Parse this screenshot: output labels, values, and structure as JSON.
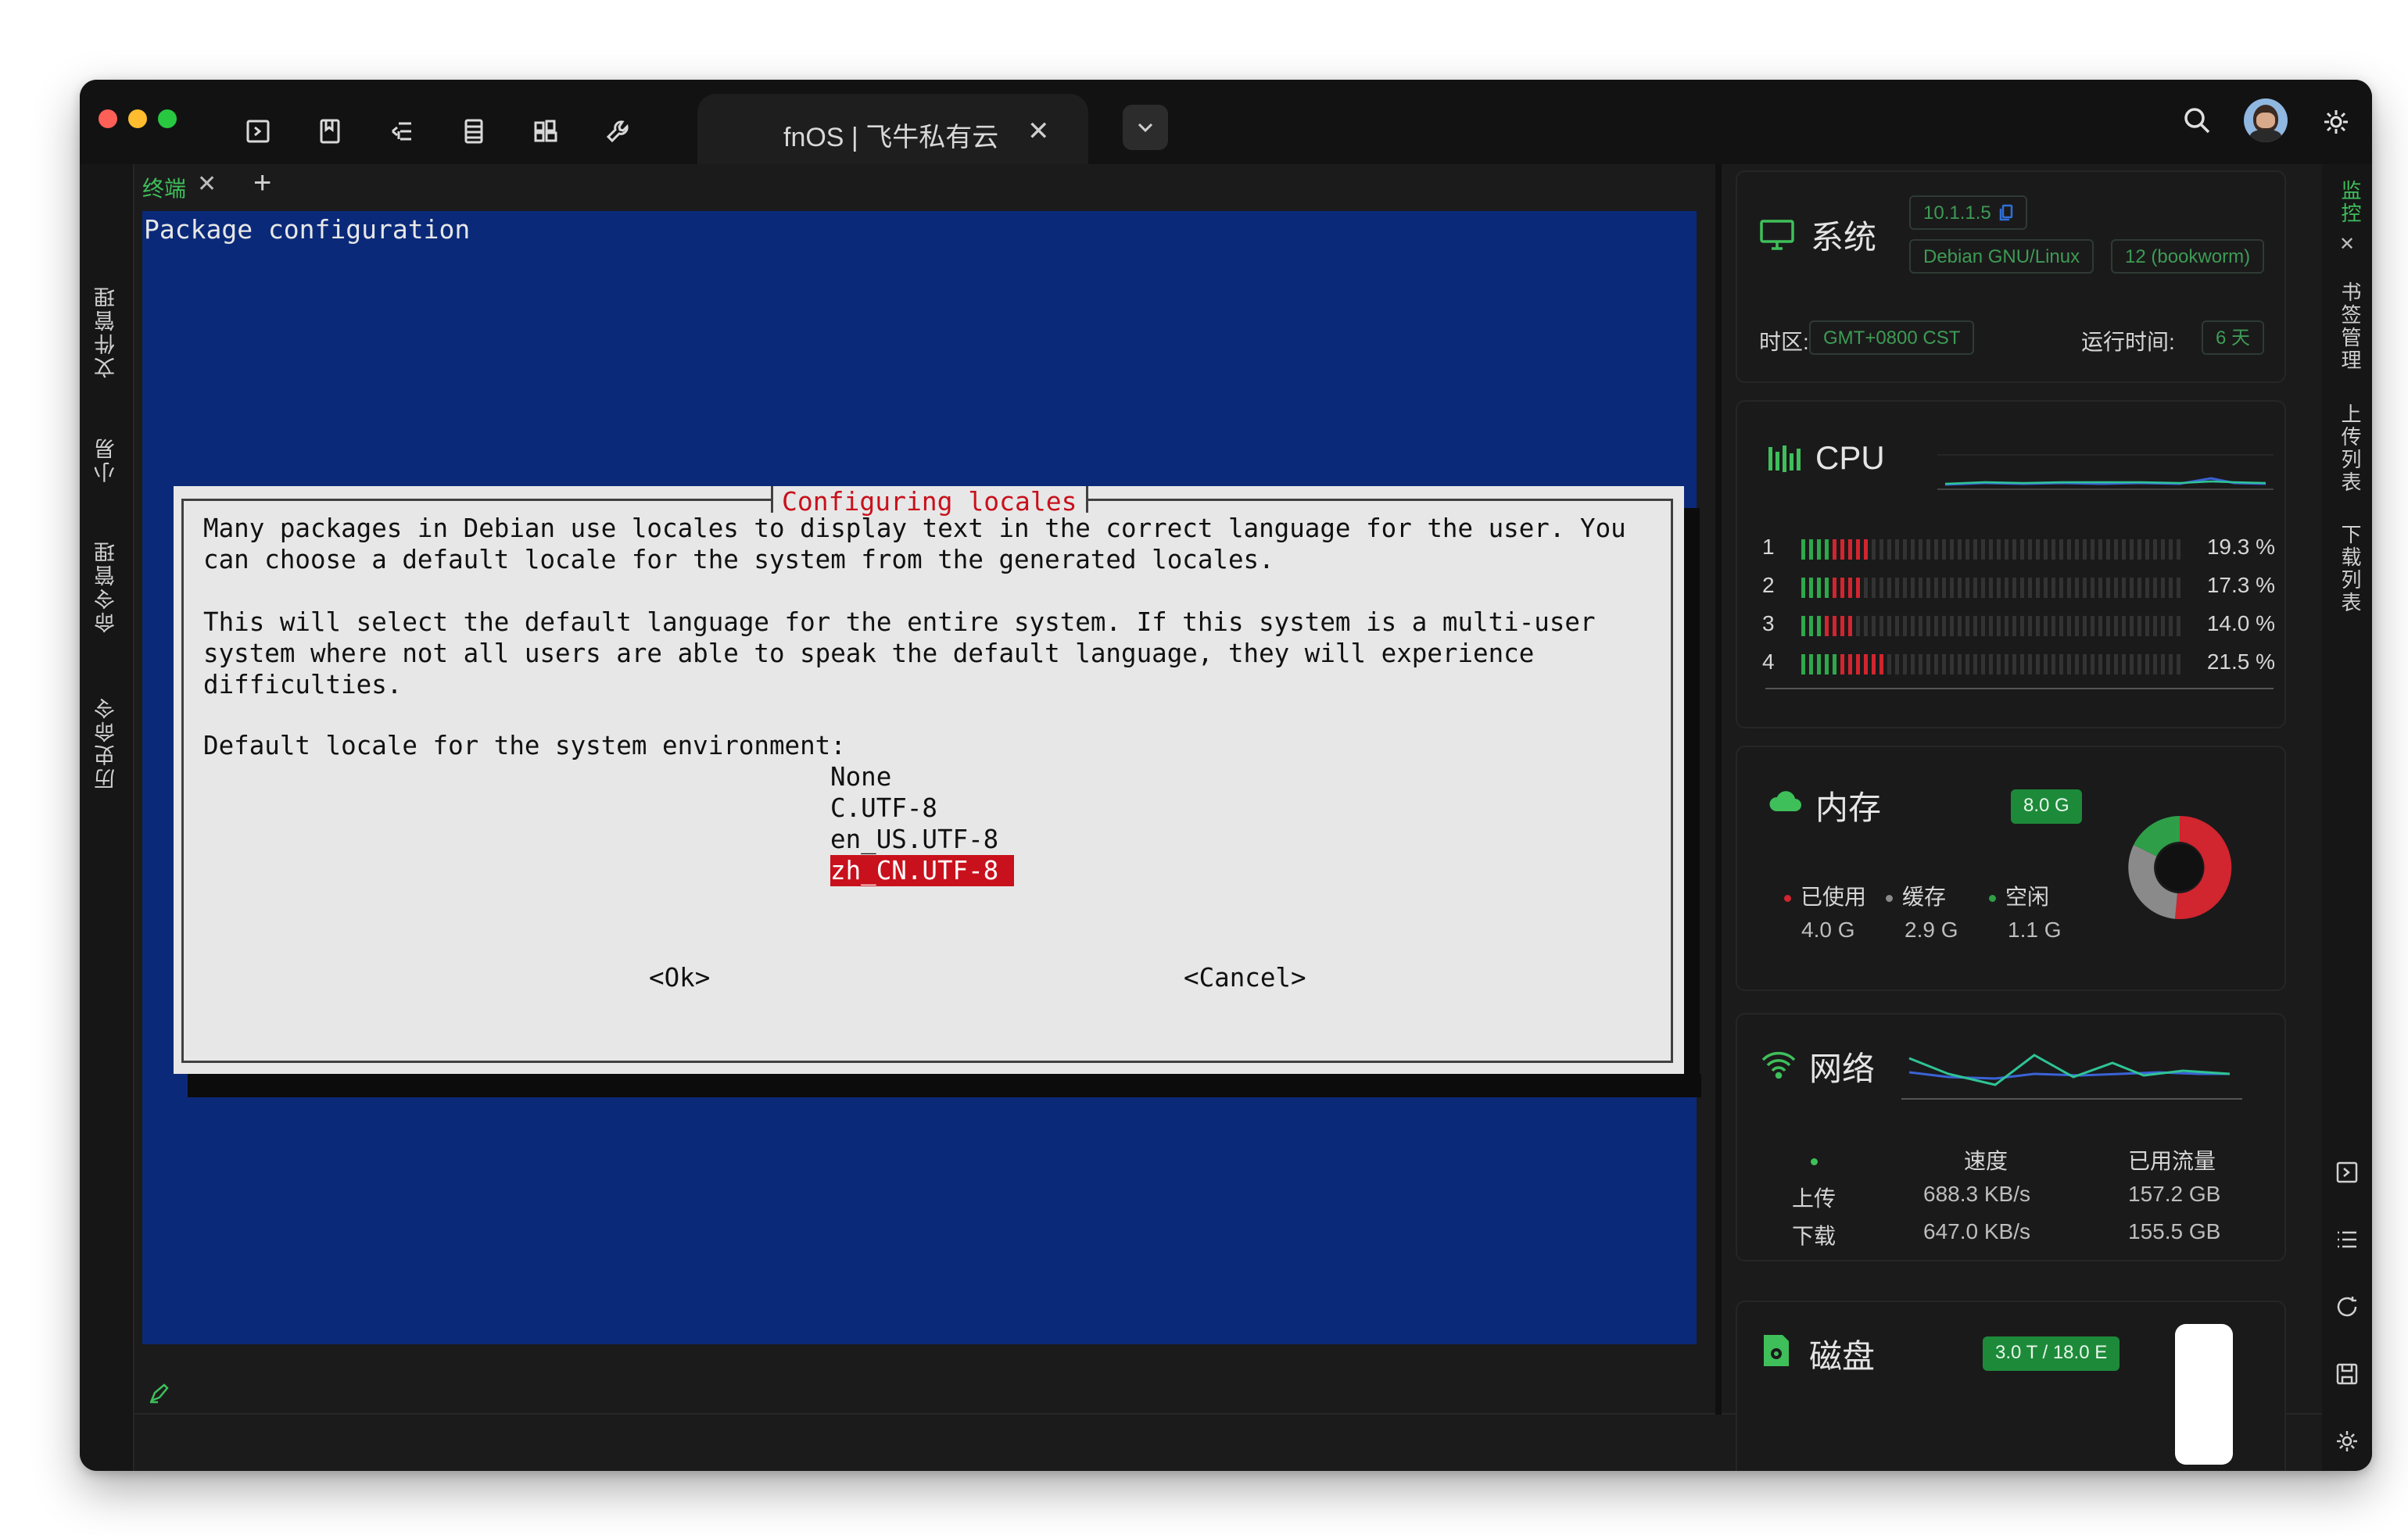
{
  "window": {
    "tab_title": "fnOS | 飞牛私有云",
    "tab_close": "✕"
  },
  "left_rail": [
    "文件管理",
    "小易",
    "命令管理",
    "历史命令"
  ],
  "right_rail": [
    "监控",
    "书签管理",
    "上传列表",
    "下载列表"
  ],
  "terminal_tab": {
    "label": "终端",
    "close": "✕",
    "add": "+",
    "close_all": "✕"
  },
  "terminal": {
    "package_title": "Package configuration",
    "dialog_title": "Configuring locales",
    "lines": [
      "Many packages in Debian use locales to display text in the correct language for the user. You",
      "can choose a default locale for the system from the generated locales.",
      "This will select the default language for the entire system. If this system is a multi-user",
      "system where not all users are able to speak the default language, they will experience",
      "difficulties.",
      "Default locale for the system environment:"
    ],
    "options": [
      "None",
      "C.UTF-8",
      "en_US.UTF-8",
      "zh_CN.UTF-8"
    ],
    "selected_option": "zh_CN.UTF-8",
    "ok_label": "<Ok>",
    "cancel_label": "<Cancel>"
  },
  "system": {
    "title": "系统",
    "version": "10.1.1.5",
    "os": "Debian GNU/Linux",
    "os_version": "12 (bookworm)",
    "timezone_label": "时区:",
    "timezone": "GMT+0800   CST",
    "uptime_label": "运行时间:",
    "uptime": "6 天"
  },
  "cpu": {
    "title": "CPU",
    "cores": [
      {
        "id": "1",
        "percent": "19.3 %",
        "value": 19.3
      },
      {
        "id": "2",
        "percent": "17.3 %",
        "value": 17.3
      },
      {
        "id": "3",
        "percent": "14.0 %",
        "value": 14.0
      },
      {
        "id": "4",
        "percent": "21.5 %",
        "value": 21.5
      }
    ]
  },
  "memory": {
    "title": "内存",
    "total": "8.0 G",
    "used_label": "已使用",
    "used": "4.0 G",
    "cache_label": "缓存",
    "cache": "2.9 G",
    "free_label": "空闲",
    "free": "1.1 G",
    "colors": {
      "used": "#d1252f",
      "cache": "#8a8a8a",
      "free": "#2e9e48"
    }
  },
  "network": {
    "title": "网络",
    "speed_label": "速度",
    "traffic_label": "已用流量",
    "upload_label": "上传",
    "download_label": "下载",
    "upload_speed": "688.3 KB/s",
    "download_speed": "647.0 KB/s",
    "upload_total": "157.2 GB",
    "download_total": "155.5 GB"
  },
  "disk": {
    "title": "磁盘",
    "usage": "3.0 T / 18.0 E"
  },
  "colors": {
    "accent": "#3fbf5a",
    "terminal_bg": "#0a2a79",
    "dialog_bg": "#e7e7e7",
    "highlight": "#c8111c"
  }
}
